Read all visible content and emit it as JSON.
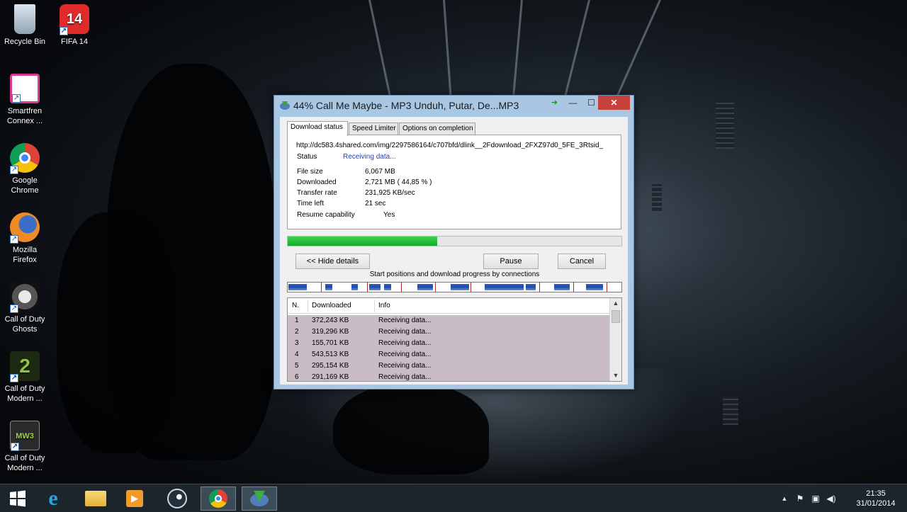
{
  "desktop_icons": [
    {
      "label": "Recycle Bin",
      "icon": "recycle-bin-icon"
    },
    {
      "label": "FIFA 14",
      "icon": "fifa-icon",
      "badge": "14"
    },
    {
      "label": "Smartfren Connex ...",
      "icon": "smartfren-icon"
    },
    {
      "label": "Google Chrome",
      "icon": "chrome-icon"
    },
    {
      "label": "Mozilla Firefox",
      "icon": "firefox-icon"
    },
    {
      "label": "Call of Duty Ghosts",
      "icon": "cod-ghosts-icon"
    },
    {
      "label": "Call of Duty Modern ...",
      "icon": "cod-mw2-icon",
      "badge": "2"
    },
    {
      "label": "Call of Duty Modern ...",
      "icon": "cod-mw3-icon",
      "badge": "MW3"
    }
  ],
  "window": {
    "title": "44% Call Me Maybe - MP3 Unduh, Putar, De...MP3",
    "close_glyph": "✕",
    "minimize_glyph": "—",
    "maximize_glyph": "☐",
    "tabs": [
      "Download status",
      "Speed Limiter",
      "Options on completion"
    ],
    "url": "http://dc583.4shared.com/img/2297586164/c707bfd/dlink__2Fdownload_2FXZ97d0_5FE_3Rtsid_",
    "status_label": "Status",
    "status_value": "Receiving data...",
    "fields": [
      {
        "label": "File size",
        "value": "6,067  MB"
      },
      {
        "label": "Downloaded",
        "value": "2,721  MB  ( 44,85 % )"
      },
      {
        "label": "Transfer rate",
        "value": "231,925  KB/sec"
      },
      {
        "label": "Time left",
        "value": "21 sec"
      },
      {
        "label": "Resume capability",
        "value": "Yes"
      }
    ],
    "progress_fraction": 0.4485,
    "buttons": {
      "hide_details": "<< Hide details",
      "pause": "Pause",
      "cancel": "Cancel"
    },
    "connections_caption": "Start positions and download progress by connections",
    "list_headers": {
      "n": "N.",
      "downloaded": "Downloaded",
      "info": "Info"
    },
    "connections": [
      {
        "n": "1",
        "downloaded": "372,243  KB",
        "info": "Receiving data..."
      },
      {
        "n": "2",
        "downloaded": "319,296  KB",
        "info": "Receiving data..."
      },
      {
        "n": "3",
        "downloaded": "155,701  KB",
        "info": "Receiving data..."
      },
      {
        "n": "4",
        "downloaded": "543,513  KB",
        "info": "Receiving data..."
      },
      {
        "n": "5",
        "downloaded": "295,154  KB",
        "info": "Receiving data..."
      },
      {
        "n": "6",
        "downloaded": "291,169  KB",
        "info": "Receiving data..."
      }
    ]
  },
  "taskbar": {
    "items": [
      "start-icon",
      "internet-explorer-icon",
      "file-explorer-icon",
      "media-player-icon",
      "steam-icon",
      "chrome-icon",
      "idm-icon"
    ],
    "tray_icons": [
      "show-hidden-icon",
      "flag-icon",
      "network-icon",
      "volume-icon"
    ],
    "time": "21:35",
    "date": "31/01/2014"
  },
  "colors": {
    "progress": "#1fb832",
    "close_button": "#c7413b",
    "window_frame": "#a9c6e3",
    "connection_segment": "#2d61c8"
  }
}
